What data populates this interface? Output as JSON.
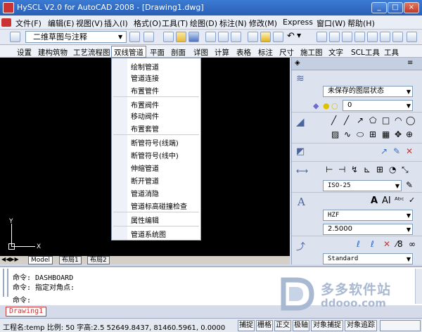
{
  "window": {
    "title": "HySCL V2.0 for AutoCAD 2008 - [Drawing1.dwg]",
    "controls": [
      "_",
      "□",
      "×"
    ]
  },
  "menubar": {
    "items": [
      "文件(F)",
      "编辑(E)",
      "视图(V)",
      "插入(I)",
      "格式(O)",
      "工具(T)",
      "绘图(D)",
      "标注(N)",
      "修改(M)",
      "Express",
      "窗口(W)",
      "帮助(H)"
    ]
  },
  "toolbar": {
    "workspace_select": "二维草图与注释"
  },
  "scl_tabs": {
    "items": [
      "设置",
      "建构筑物",
      "工艺流程图",
      "双线管道",
      "平面",
      "剖面",
      "详图",
      "计算",
      "表格",
      "标注",
      "尺寸",
      "施工图",
      "文字",
      "SCL工具",
      "工具"
    ],
    "active": "双线管道"
  },
  "dropdown": {
    "groups": [
      [
        "绘制管道",
        "管道连接",
        "布置管件"
      ],
      [
        "布置阀件",
        "移动阀件",
        "布置套管"
      ],
      [
        "断管符号(线端)",
        "断管符号(线中)",
        "伸缩管道",
        "断开管道",
        "管道消隐",
        "管道标高碰撞检查"
      ],
      [
        "属性编辑"
      ],
      [
        "管道系统图"
      ]
    ]
  },
  "canvas": {
    "axis_y": "Y",
    "axis_x": "X"
  },
  "layout_tabs": [
    "Model",
    "布局1",
    "布局2"
  ],
  "command": {
    "lines": [
      "命令: DASHBOARD",
      "命令: 指定对角点:",
      "命令:"
    ]
  },
  "doc_tab": "Drawing1",
  "palette": {
    "layer_state": "未保存的图层状态",
    "layer_current": "0",
    "dim_style": "ISO-25",
    "text_style": "HZF",
    "text_height": "2.5000",
    "mleader_style": "Standard"
  },
  "status": {
    "info": "工程名:temp 比例: 50  字高:2.5  52649.8437,  81460.5961, 0.0000",
    "buttons": [
      "捕捉",
      "栅格",
      "正交",
      "极轴",
      "对象捕捉",
      "对象追踪"
    ]
  },
  "watermark": {
    "line1": "多多软件站",
    "line2": "ddooo.com"
  },
  "colors": {
    "title_bar": "#2a5fb7",
    "canvas": "#000000",
    "doc_tab": "#cc3333"
  }
}
